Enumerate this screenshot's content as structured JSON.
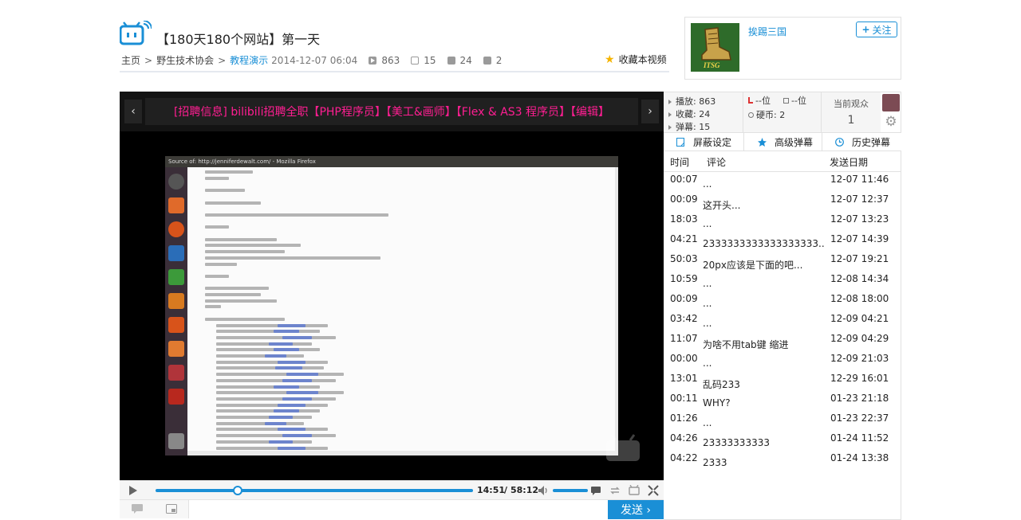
{
  "video": {
    "title": "【180天180个网站】第一天",
    "breadcrumb": [
      "主页",
      "野生技术协会",
      "教程演示"
    ],
    "breadcrumb_sep": ">",
    "date": "2014-12-07 06:04",
    "stats": {
      "plays": "863",
      "comments": "15",
      "favorites": "24",
      "coins": "2"
    },
    "favorite_label": "收藏本视频"
  },
  "uploader": {
    "name": "挨踢三国",
    "avatar_text": "ITSG",
    "follow_label": "关注",
    "follow_icon": "plus-icon"
  },
  "player": {
    "ad_text": "[招聘信息] bilibili招聘全职【PHP程序员】【美工&画师】【Flex & AS3 程序员】【编辑】",
    "ad_prev": "‹",
    "ad_next": "›",
    "screen_title": "Source of: http://jenniferdewalt.com/ - Mozilla Firefox",
    "current_time": "14:51",
    "time_sep": "/",
    "total_time": "58:12",
    "progress": 0.26,
    "volume": 1.0,
    "send_label": "发送 ›"
  },
  "side": {
    "stats": [
      {
        "label": "播放: 863"
      },
      {
        "label": "收藏: 24"
      },
      {
        "label": "弹幕: 15"
      }
    ],
    "ranks": [
      "--位",
      "--位",
      "硬币: 2"
    ],
    "viewers_label": "当前观众",
    "viewers_count": "1",
    "tabs": [
      "屏蔽设定",
      "高级弹幕",
      "历史弹幕"
    ],
    "list_headers": {
      "time": "时间",
      "comment": "评论",
      "date": "发送日期"
    },
    "comments": [
      {
        "time": "00:07",
        "text": "...",
        "date": "12-07 11:46"
      },
      {
        "time": "00:09",
        "text": "这开头...",
        "date": "12-07 12:37"
      },
      {
        "time": "18:03",
        "text": "...",
        "date": "12-07 13:23"
      },
      {
        "time": "04:21",
        "text": "2333333333333333333...",
        "date": "12-07 14:39"
      },
      {
        "time": "50:03",
        "text": "20px应该是下面的吧...",
        "date": "12-07 19:21"
      },
      {
        "time": "10:59",
        "text": "...",
        "date": "12-08 14:34"
      },
      {
        "time": "00:09",
        "text": "...",
        "date": "12-08 18:00"
      },
      {
        "time": "03:42",
        "text": "...",
        "date": "12-09 04:21"
      },
      {
        "time": "11:07",
        "text": "为啥不用tab键 缩进",
        "date": "12-09 04:29"
      },
      {
        "time": "00:00",
        "text": "...",
        "date": "12-09 21:03"
      },
      {
        "time": "13:01",
        "text": "乱码233",
        "date": "12-29 16:01"
      },
      {
        "time": "00:11",
        "text": "WHY?",
        "date": "01-23 21:18"
      },
      {
        "time": "01:26",
        "text": "...",
        "date": "01-23 22:37"
      },
      {
        "time": "04:26",
        "text": "23333333333",
        "date": "01-24 11:52"
      },
      {
        "time": "04:22",
        "text": "2333",
        "date": "01-24 13:38"
      }
    ]
  },
  "colors": {
    "accent": "#1a8fd6",
    "ad_text": "#ff1e92",
    "star": "#f5b400"
  }
}
